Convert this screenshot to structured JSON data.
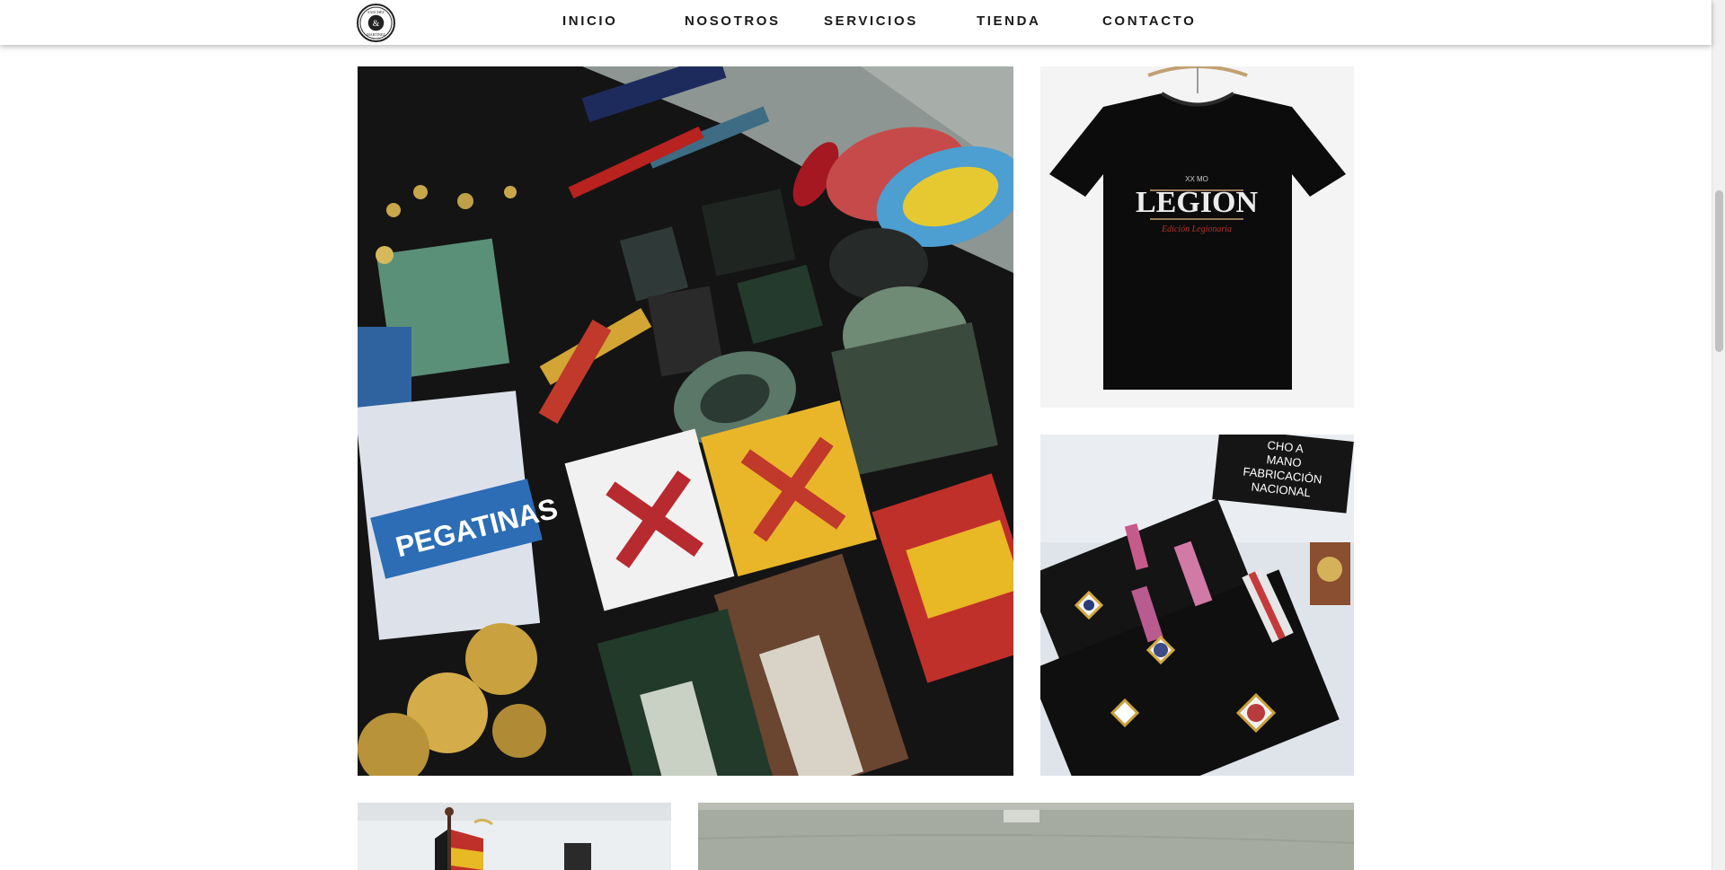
{
  "brand": {
    "logo_text_top": "SANCHEZ",
    "logo_text_center": "&",
    "logo_text_bottom": "MARTINEZ"
  },
  "nav": {
    "items": [
      {
        "label": "INICIO"
      },
      {
        "label": "NOSOTROS"
      },
      {
        "label": "SERVICIOS"
      },
      {
        "label": "TIENDA"
      },
      {
        "label": "CONTACTO"
      }
    ]
  },
  "gallery": {
    "tshirt_print": "LEGION",
    "tshirt_years": "XX   MO",
    "tshirt_subtitle": "Edición Legionaria",
    "patches_sticker": "PEGATINAS",
    "medals_sign_lines": [
      "CHO A",
      "MANO",
      "FABRICACIÓN",
      "NACIONAL"
    ]
  },
  "colors": {
    "nav_text": "#1a1a1a",
    "nav_bg": "#ffffff",
    "page_bg": "#ffffff"
  }
}
